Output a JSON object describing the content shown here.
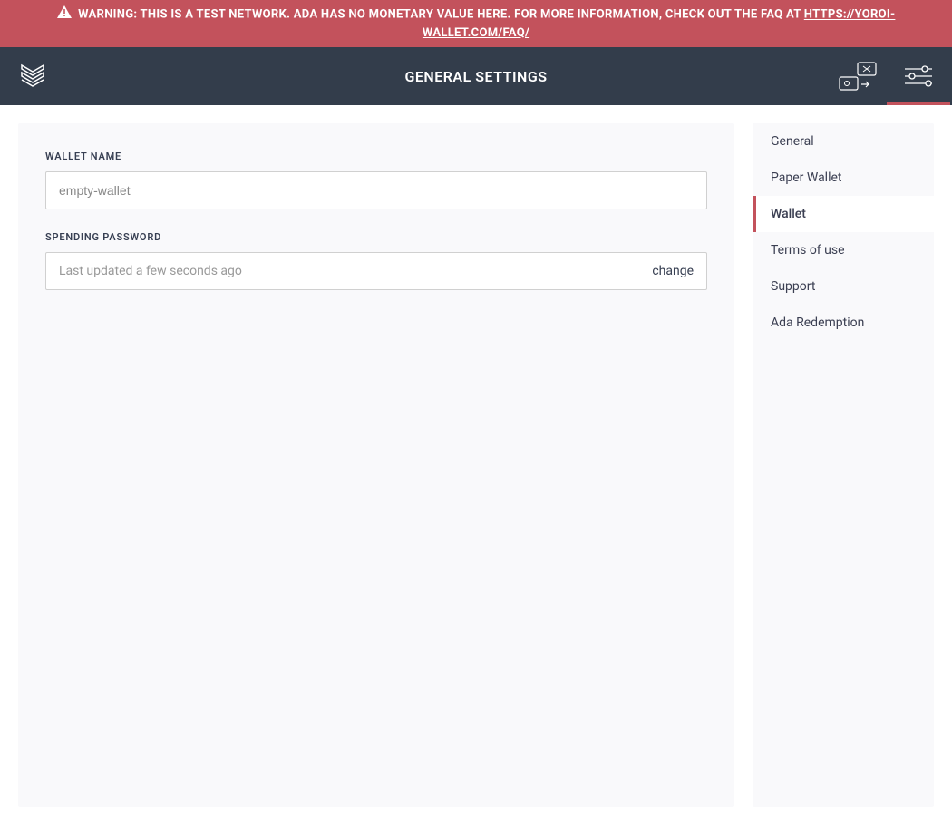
{
  "banner": {
    "text_before": "WARNING: THIS IS A TEST NETWORK. ADA HAS NO MONETARY VALUE HERE. FOR MORE INFORMATION, CHECK OUT THE FAQ AT",
    "link_text": "HTTPS://YOROI-WALLET.COM/FAQ/"
  },
  "header": {
    "title": "GENERAL SETTINGS"
  },
  "icons": {
    "logo": "yoroi-logo",
    "transfer": "wallets-transfer-icon",
    "settings": "settings-sliders-icon"
  },
  "content": {
    "wallet_name_label": "WALLET NAME",
    "wallet_name_value": "empty-wallet",
    "spending_password_label": "SPENDING PASSWORD",
    "spending_password_status": "Last updated a few seconds ago",
    "change_label": "change"
  },
  "sidebar": {
    "items": [
      {
        "label": "General",
        "active": false
      },
      {
        "label": "Paper Wallet",
        "active": false
      },
      {
        "label": "Wallet",
        "active": true
      },
      {
        "label": "Terms of use",
        "active": false
      },
      {
        "label": "Support",
        "active": false
      },
      {
        "label": "Ada Redemption",
        "active": false
      }
    ]
  }
}
